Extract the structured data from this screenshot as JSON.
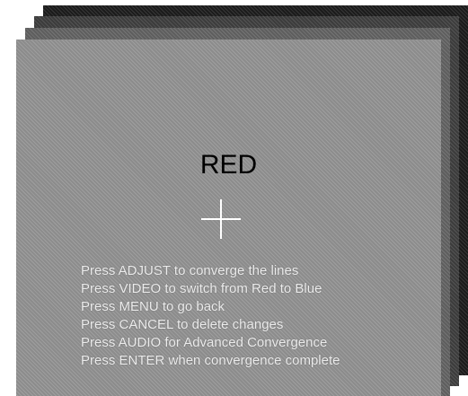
{
  "screen": {
    "color_mode": "RED",
    "instructions": [
      "Press ADJUST to converge the lines",
      "Press VIDEO to switch from Red to Blue",
      "Press MENU to go back",
      "Press CANCEL to delete changes",
      "Press AUDIO for Advanced Convergence",
      "Press ENTER when convergence complete"
    ]
  },
  "colors": {
    "panel_front": "#8c8c8c",
    "panel_back": "#1b1b1b",
    "crosshair": "#ffffff",
    "label": "#000000",
    "instruction_text": "#ececec"
  },
  "icons": {
    "crosshair": "convergence-crosshair-icon"
  }
}
